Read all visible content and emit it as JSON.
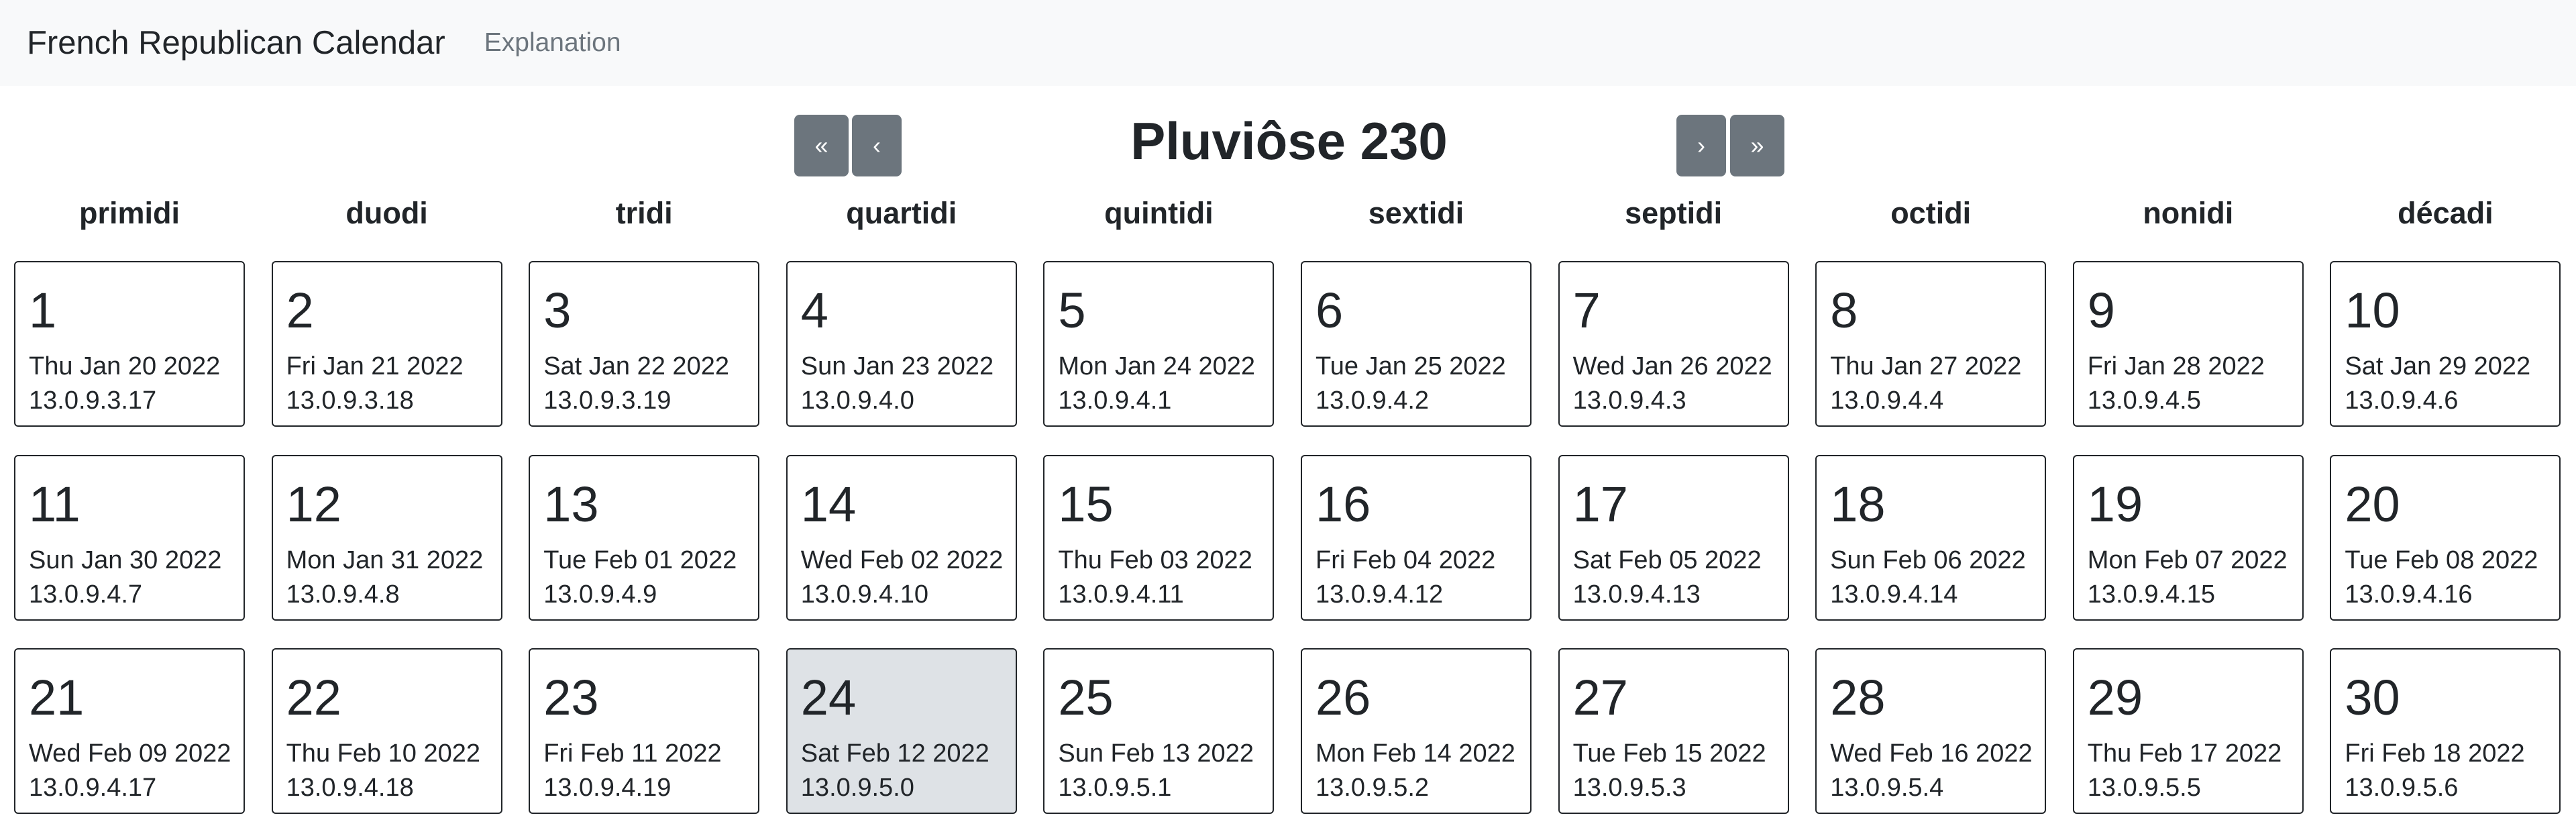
{
  "navbar": {
    "brand": "French Republican Calendar",
    "links": [
      "Explanation"
    ]
  },
  "header": {
    "title": "Pluviôse 230",
    "first_label": "«",
    "prev_label": "‹",
    "next_label": "›",
    "last_label": "»"
  },
  "weekdays": [
    "primidi",
    "duodi",
    "tridi",
    "quartidi",
    "quintidi",
    "sextidi",
    "septidi",
    "octidi",
    "nonidi",
    "décadi"
  ],
  "today_day": 24,
  "days": [
    {
      "num": "1",
      "greg": "Thu Jan 20 2022",
      "mayan": "13.0.9.3.17"
    },
    {
      "num": "2",
      "greg": "Fri Jan 21 2022",
      "mayan": "13.0.9.3.18"
    },
    {
      "num": "3",
      "greg": "Sat Jan 22 2022",
      "mayan": "13.0.9.3.19"
    },
    {
      "num": "4",
      "greg": "Sun Jan 23 2022",
      "mayan": "13.0.9.4.0"
    },
    {
      "num": "5",
      "greg": "Mon Jan 24 2022",
      "mayan": "13.0.9.4.1"
    },
    {
      "num": "6",
      "greg": "Tue Jan 25 2022",
      "mayan": "13.0.9.4.2"
    },
    {
      "num": "7",
      "greg": "Wed Jan 26 2022",
      "mayan": "13.0.9.4.3"
    },
    {
      "num": "8",
      "greg": "Thu Jan 27 2022",
      "mayan": "13.0.9.4.4"
    },
    {
      "num": "9",
      "greg": "Fri Jan 28 2022",
      "mayan": "13.0.9.4.5"
    },
    {
      "num": "10",
      "greg": "Sat Jan 29 2022",
      "mayan": "13.0.9.4.6"
    },
    {
      "num": "11",
      "greg": "Sun Jan 30 2022",
      "mayan": "13.0.9.4.7"
    },
    {
      "num": "12",
      "greg": "Mon Jan 31 2022",
      "mayan": "13.0.9.4.8"
    },
    {
      "num": "13",
      "greg": "Tue Feb 01 2022",
      "mayan": "13.0.9.4.9"
    },
    {
      "num": "14",
      "greg": "Wed Feb 02 2022",
      "mayan": "13.0.9.4.10"
    },
    {
      "num": "15",
      "greg": "Thu Feb 03 2022",
      "mayan": "13.0.9.4.11"
    },
    {
      "num": "16",
      "greg": "Fri Feb 04 2022",
      "mayan": "13.0.9.4.12"
    },
    {
      "num": "17",
      "greg": "Sat Feb 05 2022",
      "mayan": "13.0.9.4.13"
    },
    {
      "num": "18",
      "greg": "Sun Feb 06 2022",
      "mayan": "13.0.9.4.14"
    },
    {
      "num": "19",
      "greg": "Mon Feb 07 2022",
      "mayan": "13.0.9.4.15"
    },
    {
      "num": "20",
      "greg": "Tue Feb 08 2022",
      "mayan": "13.0.9.4.16"
    },
    {
      "num": "21",
      "greg": "Wed Feb 09 2022",
      "mayan": "13.0.9.4.17"
    },
    {
      "num": "22",
      "greg": "Thu Feb 10 2022",
      "mayan": "13.0.9.4.18"
    },
    {
      "num": "23",
      "greg": "Fri Feb 11 2022",
      "mayan": "13.0.9.4.19"
    },
    {
      "num": "24",
      "greg": "Sat Feb 12 2022",
      "mayan": "13.0.9.5.0"
    },
    {
      "num": "25",
      "greg": "Sun Feb 13 2022",
      "mayan": "13.0.9.5.1"
    },
    {
      "num": "26",
      "greg": "Mon Feb 14 2022",
      "mayan": "13.0.9.5.2"
    },
    {
      "num": "27",
      "greg": "Tue Feb 15 2022",
      "mayan": "13.0.9.5.3"
    },
    {
      "num": "28",
      "greg": "Wed Feb 16 2022",
      "mayan": "13.0.9.5.4"
    },
    {
      "num": "29",
      "greg": "Thu Feb 17 2022",
      "mayan": "13.0.9.5.5"
    },
    {
      "num": "30",
      "greg": "Fri Feb 18 2022",
      "mayan": "13.0.9.5.6"
    }
  ]
}
